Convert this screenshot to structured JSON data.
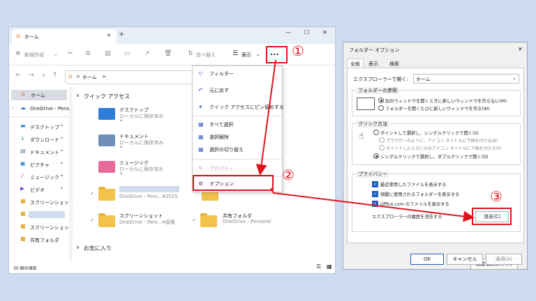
{
  "explorer": {
    "tab_title": "ホーム",
    "new_tab": "+",
    "window_controls": [
      "—",
      "☐",
      "✕"
    ],
    "toolbar": {
      "new_label": "新規作成",
      "sort_label": "並べ替え",
      "view_label": "表示",
      "more_label": "..."
    },
    "address": {
      "path_home": "ホーム",
      "path_sep": ">"
    },
    "sidebar": {
      "items": [
        {
          "label": "ホーム",
          "icon": "home-icon"
        },
        {
          "label": "OneDrive - Perso",
          "icon": "cloud-icon"
        },
        {
          "label": "デスクトップ",
          "icon": "desktop-icon"
        },
        {
          "label": "ダウンロード",
          "icon": "download-icon"
        },
        {
          "label": "ドキュメント",
          "icon": "document-icon"
        },
        {
          "label": "ピクチャ",
          "icon": "picture-icon"
        },
        {
          "label": "ミュージック",
          "icon": "music-icon"
        },
        {
          "label": "ビデオ",
          "icon": "video-icon"
        },
        {
          "label": "スクリーンショット",
          "icon": "folder-icon"
        },
        {
          "label": "",
          "icon": "folder-icon"
        },
        {
          "label": "スクリーンショット",
          "icon": "folder-icon"
        },
        {
          "label": "共有フォルダ",
          "icon": "folder-icon"
        }
      ]
    },
    "quick_access": {
      "heading": "クイック アクセス",
      "items": [
        {
          "name": "デスクトップ",
          "sub": "ローカルに保存済み"
        },
        {
          "name": "ドキュメント",
          "sub": "ローカルに保存済み"
        },
        {
          "name": "ミュージック",
          "sub": "ローカルに保存済み"
        },
        {
          "name": "",
          "sub": "OneDrive - Pers...¥2025"
        },
        {
          "name": "スクリーンショット",
          "sub": "OneDrive - Pers...¥画像"
        }
      ],
      "right_items": [
        {
          "name": "ピクチャ",
          "sub": ""
        },
        {
          "name": "共有フォルダ",
          "sub": "OneDrive - Personal"
        }
      ]
    },
    "favorites_heading": "お気に入り",
    "status": "30 個の項目"
  },
  "menu": {
    "items": [
      {
        "label": "フィルター",
        "icon": "filter-icon"
      },
      {
        "label": "元に戻す",
        "icon": "undo-icon"
      },
      {
        "label": "クイック アクセスにピン留めする",
        "icon": "pin-icon"
      },
      {
        "label": "すべて選択",
        "icon": "select-all-icon"
      },
      {
        "label": "選択解除",
        "icon": "select-none-icon"
      },
      {
        "label": "選択の切り替え",
        "icon": "invert-selection-icon"
      },
      {
        "label": "プロパティ",
        "icon": "properties-icon"
      },
      {
        "label": "オプション",
        "icon": "options-icon"
      }
    ]
  },
  "dialog": {
    "title": "フォルダー オプション",
    "close": "✕",
    "tabs": [
      "全般",
      "表示",
      "検索"
    ],
    "open_in_label": "エクスプローラーで開く:",
    "open_in_value": "ホーム",
    "browse": {
      "title": "フォルダーの参照",
      "options": [
        "別のウィンドウを開くときに新しいウィンドウを作らない(M)",
        "フォルダーを開くたびに新しいウィンドウを作る(W)"
      ]
    },
    "click": {
      "title": "クリック方法",
      "options": [
        "ポイントして選択し、シングルクリックで開く(S)",
        "ブラウザーのように、アイコン タイトルに下線を付ける(B)",
        "ポイントしたときにのみアイコン タイトルに下線を付ける(P)",
        "シングルクリックで選択し、ダブルクリックで開く(D)"
      ]
    },
    "privacy": {
      "title": "プライバシー",
      "options": [
        "最近使用したファイルを表示する",
        "頻繁に使用されるフォルダーを表示する",
        "Office.com のファイルを表示する"
      ],
      "clear_label": "エクスプローラーの履歴を消去する",
      "clear_button": "消去(C)"
    },
    "restore_button": "既定値に戻す(R)",
    "ok": "OK",
    "cancel": "キャンセル",
    "apply": "適用(A)"
  },
  "annotations": [
    "①",
    "②",
    "③"
  ],
  "colors": {
    "highlight": "#e0131c",
    "accent": "#1f5fbf",
    "folder": "#f2c34a"
  }
}
